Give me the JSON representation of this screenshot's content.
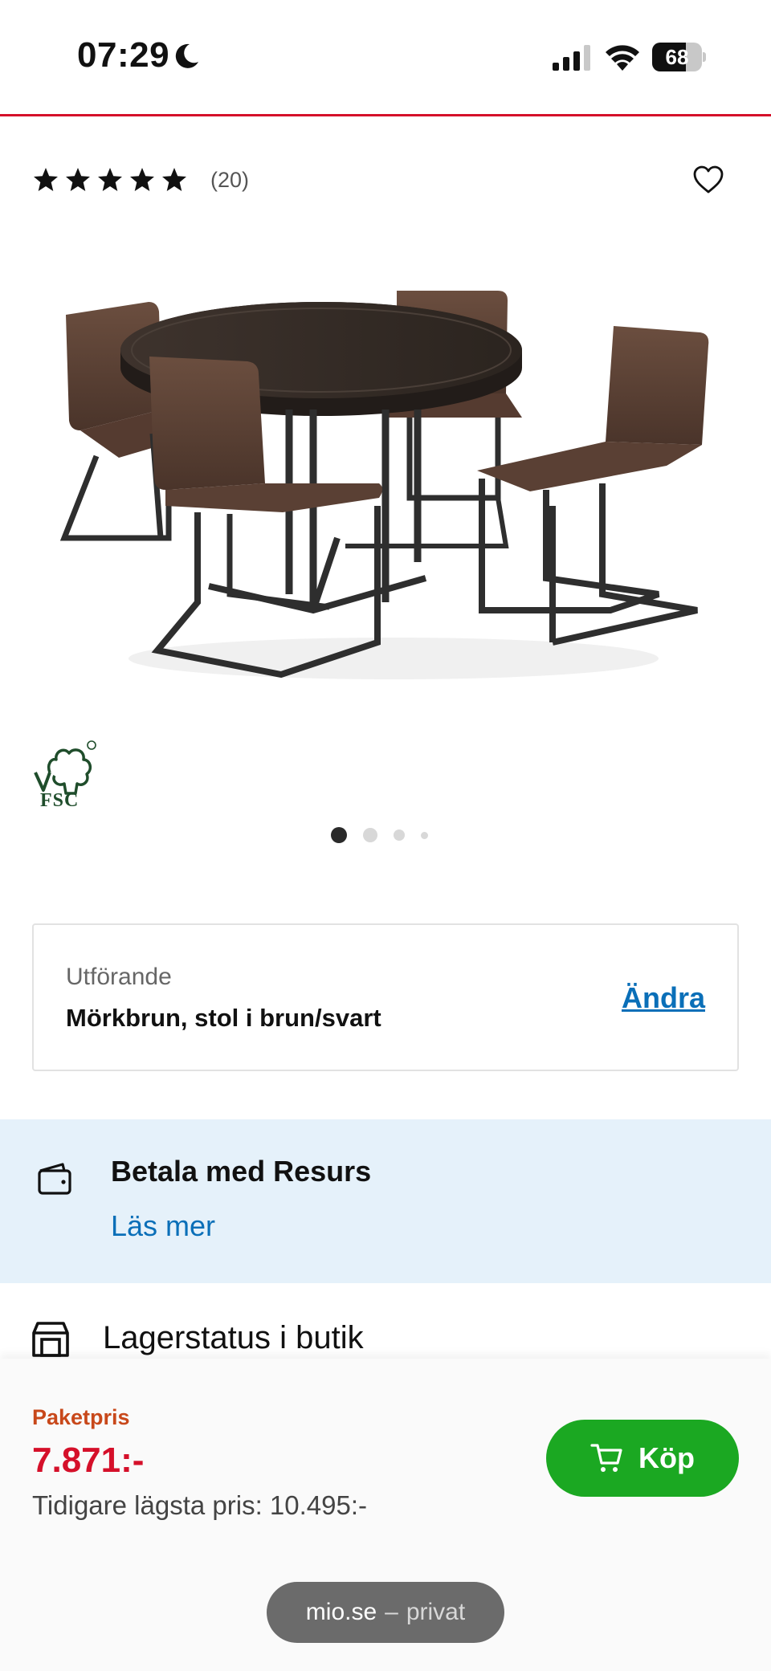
{
  "status_bar": {
    "time": "07:29",
    "battery": "68",
    "battery_level": 0.68
  },
  "product": {
    "rating_stars": 5,
    "review_count": "(20)",
    "image_dot_count": 4,
    "active_image_index": 0,
    "certification": "FSC"
  },
  "variant": {
    "label": "Utförande",
    "value": "Mörkbrun, stol i brun/svart",
    "change_label": "Ändra"
  },
  "payment": {
    "title": "Betala med Resurs",
    "link": "Läs mer"
  },
  "store_stock": {
    "label": "Lagerstatus i butik"
  },
  "purchase": {
    "package_label": "Paketpris",
    "price": "7.871:-",
    "previous_price": "Tidigare lägsta pris: 10.495:-",
    "buy_label": "Köp"
  },
  "browser": {
    "domain": "mio.se",
    "separator": "–",
    "mode": "privat"
  },
  "colors": {
    "accent_red": "#d5102a",
    "link_blue": "#0a6fb8",
    "buy_green": "#1ba822",
    "package_orange": "#c8481a",
    "info_bg": "#e5f1fa"
  },
  "icons": {
    "moon": "moon-icon",
    "signal": "cellular-signal-icon",
    "wifi": "wifi-icon",
    "battery": "battery-icon",
    "star": "star-icon",
    "heart": "heart-icon",
    "wallet": "wallet-icon",
    "store": "store-icon",
    "cart": "cart-icon"
  }
}
